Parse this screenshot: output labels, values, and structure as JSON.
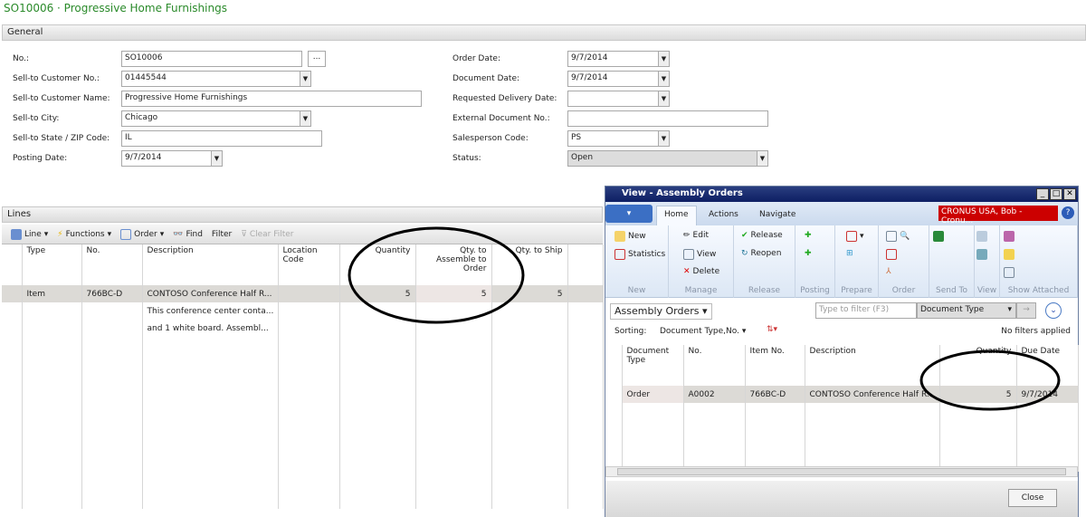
{
  "page_title": "SO10006 · Progressive Home Furnishings",
  "general": {
    "header": "General",
    "left": [
      {
        "label": "No.:",
        "value": "SO10006"
      },
      {
        "label": "Sell-to Customer No.:",
        "value": "01445544"
      },
      {
        "label": "Sell-to Customer Name:",
        "value": "Progressive Home Furnishings"
      },
      {
        "label": "Sell-to City:",
        "value": "Chicago"
      },
      {
        "label": "Sell-to State / ZIP Code:",
        "value": "IL"
      },
      {
        "label": "Posting Date:",
        "value": "9/7/2014"
      }
    ],
    "right": [
      {
        "label": "Order Date:",
        "value": "9/7/2014"
      },
      {
        "label": "Document Date:",
        "value": "9/7/2014"
      },
      {
        "label": "Requested Delivery Date:",
        "value": ""
      },
      {
        "label": "External Document No.:",
        "value": ""
      },
      {
        "label": "Salesperson Code:",
        "value": "PS"
      },
      {
        "label": "Status:",
        "value": "Open"
      }
    ],
    "assist_button": "..."
  },
  "lines": {
    "header": "Lines",
    "toolbar": {
      "line": "Line",
      "functions": "Functions",
      "order": "Order",
      "find": "Find",
      "filter": "Filter",
      "clear_filter": "Clear Filter"
    },
    "columns": [
      "Type",
      "No.",
      "Description",
      "Location Code",
      "Quantity",
      "Qty. to Assemble to Order",
      "Qty. to Ship"
    ],
    "rows": [
      [
        "Item",
        "766BC-D",
        "CONTOSO Conference Half R...",
        "",
        "5",
        "5",
        "5"
      ],
      [
        "",
        "",
        "This conference center conta...",
        "",
        "",
        "",
        ""
      ],
      [
        "",
        "",
        "and 1 white board.  Assembl...",
        "",
        "",
        "",
        ""
      ]
    ]
  },
  "popup": {
    "title": "View - Assembly Orders",
    "tabs": [
      "Home",
      "Actions",
      "Navigate"
    ],
    "company": "CRONUS USA, Bob - Cronu...",
    "ribbon": {
      "new": "New",
      "statistics": "Statistics",
      "edit": "Edit",
      "view": "View",
      "delete": "Delete",
      "release": "Release",
      "reopen": "Reopen",
      "groups": [
        "New",
        "Manage",
        "Release",
        "Posting",
        "Prepare",
        "Order",
        "Send To",
        "View",
        "Show Attached"
      ]
    },
    "view_name": "Assembly Orders",
    "filter_placeholder": "Type to filter (F3)",
    "filter_field": "Document Type",
    "sorting_label": "Sorting:",
    "sorting_value": "Document Type,No.",
    "filter_status": "No filters applied",
    "columns": [
      "Document Type",
      "No.",
      "Item No.",
      "Description",
      "Quantity",
      "Due Date"
    ],
    "rows": [
      [
        "Order",
        "A0002",
        "766BC-D",
        "CONTOSO Conference Half R...",
        "5",
        "9/7/2014"
      ]
    ],
    "close": "Close"
  },
  "colors": {
    "title": "#2a8a2a",
    "window_title_bar": "#0d1e63",
    "company_badge": "#cc0000",
    "annotation": "#000000"
  }
}
